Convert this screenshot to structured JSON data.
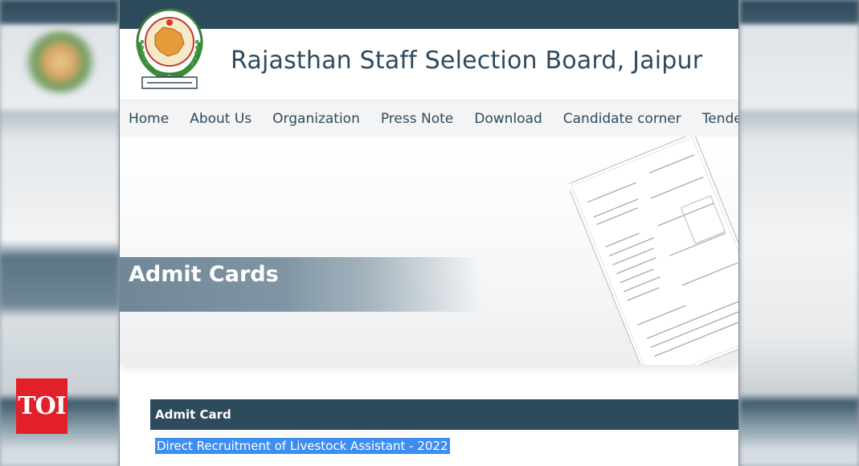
{
  "site": {
    "title": "Rajasthan Staff Selection Board, Jaipur",
    "logo_icon": "rsssb-emblem-icon"
  },
  "nav": {
    "items": [
      {
        "label": "Home"
      },
      {
        "label": "About Us"
      },
      {
        "label": "Organization"
      },
      {
        "label": "Press Note"
      },
      {
        "label": "Download"
      },
      {
        "label": "Candidate corner"
      },
      {
        "label": "Tender"
      }
    ]
  },
  "banner": {
    "title": "Admit Cards",
    "image_icon": "application-form-icon"
  },
  "table": {
    "header": "Admit Card",
    "rows": [
      {
        "label": "Direct Recruitment of Livestock Assistant - 2022"
      }
    ]
  },
  "watermark": {
    "label": "TOI"
  },
  "colors": {
    "primary": "#2e4a5d",
    "nav_text": "#2f4a5c",
    "selection": "#3e8ef0",
    "toi_red": "#e2202a"
  }
}
